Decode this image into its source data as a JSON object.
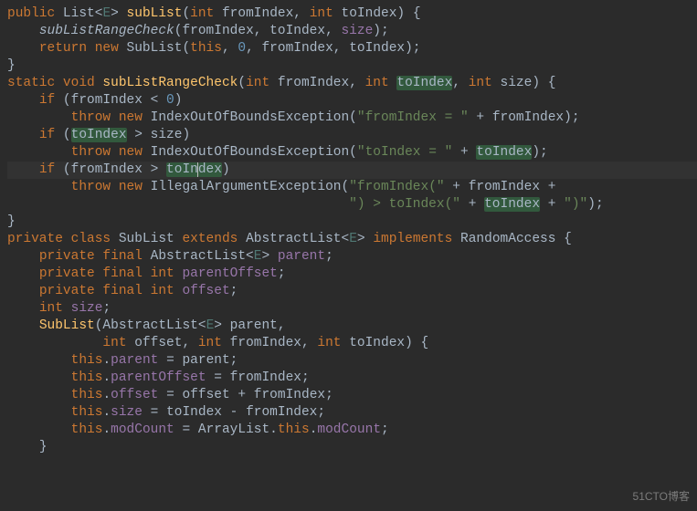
{
  "watermark": "51CTO博客",
  "highlighted_identifier": "toIndex",
  "cursor": {
    "line_index": 10,
    "col": 27
  },
  "code_lines": [
    {
      "indent": 0,
      "tokens": [
        {
          "t": "public ",
          "c": "kw"
        },
        {
          "t": "List",
          "c": "type"
        },
        {
          "t": "<",
          "c": ""
        },
        {
          "t": "E",
          "c": "gen"
        },
        {
          "t": "> ",
          "c": ""
        },
        {
          "t": "subList",
          "c": "mdef"
        },
        {
          "t": "(",
          "c": ""
        },
        {
          "t": "int ",
          "c": "kw"
        },
        {
          "t": "fromIndex, ",
          "c": ""
        },
        {
          "t": "int ",
          "c": "kw"
        },
        {
          "t": "toIndex) {",
          "c": ""
        }
      ]
    },
    {
      "indent": 4,
      "tokens": [
        {
          "t": "subListRangeCheck",
          "c": "ital"
        },
        {
          "t": "(fromIndex, toIndex, ",
          "c": ""
        },
        {
          "t": "size",
          "c": "field"
        },
        {
          "t": ");",
          "c": ""
        }
      ]
    },
    {
      "indent": 4,
      "tokens": [
        {
          "t": "return new ",
          "c": "kw"
        },
        {
          "t": "SubList(",
          "c": ""
        },
        {
          "t": "this",
          "c": "kw"
        },
        {
          "t": ", ",
          "c": ""
        },
        {
          "t": "0",
          "c": "num"
        },
        {
          "t": ", fromIndex, toIndex);",
          "c": ""
        }
      ]
    },
    {
      "indent": 0,
      "tokens": [
        {
          "t": "}",
          "c": ""
        }
      ]
    },
    {
      "indent": 0,
      "tokens": []
    },
    {
      "indent": 0,
      "tokens": [
        {
          "t": "static void ",
          "c": "kw"
        },
        {
          "t": "subListRangeCheck",
          "c": "mdef"
        },
        {
          "t": "(",
          "c": ""
        },
        {
          "t": "int ",
          "c": "kw"
        },
        {
          "t": "fromIndex, ",
          "c": ""
        },
        {
          "t": "int ",
          "c": "kw"
        },
        {
          "t": "toIndex",
          "c": "hl"
        },
        {
          "t": ", ",
          "c": ""
        },
        {
          "t": "int ",
          "c": "kw"
        },
        {
          "t": "size) {",
          "c": ""
        }
      ]
    },
    {
      "indent": 4,
      "tokens": [
        {
          "t": "if ",
          "c": "kw"
        },
        {
          "t": "(fromIndex < ",
          "c": ""
        },
        {
          "t": "0",
          "c": "num"
        },
        {
          "t": ")",
          "c": ""
        }
      ]
    },
    {
      "indent": 8,
      "tokens": [
        {
          "t": "throw new ",
          "c": "kw"
        },
        {
          "t": "IndexOutOfBoundsException(",
          "c": ""
        },
        {
          "t": "\"fromIndex = \"",
          "c": "str"
        },
        {
          "t": " + fromIndex);",
          "c": ""
        }
      ]
    },
    {
      "indent": 4,
      "tokens": [
        {
          "t": "if ",
          "c": "kw"
        },
        {
          "t": "(",
          "c": ""
        },
        {
          "t": "toIndex",
          "c": "hl"
        },
        {
          "t": " > size)",
          "c": ""
        }
      ]
    },
    {
      "indent": 8,
      "tokens": [
        {
          "t": "throw new ",
          "c": "kw"
        },
        {
          "t": "IndexOutOfBoundsException(",
          "c": ""
        },
        {
          "t": "\"toIndex = \"",
          "c": "str"
        },
        {
          "t": " + ",
          "c": ""
        },
        {
          "t": "toIndex",
          "c": "hl"
        },
        {
          "t": ");",
          "c": ""
        }
      ]
    },
    {
      "indent": 4,
      "current": true,
      "tokens": [
        {
          "t": "if ",
          "c": "kw"
        },
        {
          "t": "(fromIndex > ",
          "c": ""
        },
        {
          "t": "toIn",
          "c": "hl"
        },
        {
          "t": "",
          "c": "caret"
        },
        {
          "t": "dex",
          "c": "hl"
        },
        {
          "t": ")",
          "c": ""
        }
      ]
    },
    {
      "indent": 8,
      "tokens": [
        {
          "t": "throw new ",
          "c": "kw"
        },
        {
          "t": "IllegalArgumentException(",
          "c": ""
        },
        {
          "t": "\"fromIndex(\"",
          "c": "str"
        },
        {
          "t": " + fromIndex +",
          "c": ""
        }
      ]
    },
    {
      "indent": 43,
      "tokens": [
        {
          "t": "\") > toIndex(\"",
          "c": "str"
        },
        {
          "t": " + ",
          "c": ""
        },
        {
          "t": "toIndex",
          "c": "hl"
        },
        {
          "t": " + ",
          "c": ""
        },
        {
          "t": "\")\"",
          "c": "str"
        },
        {
          "t": ");",
          "c": ""
        }
      ]
    },
    {
      "indent": 0,
      "tokens": [
        {
          "t": "}",
          "c": ""
        }
      ]
    },
    {
      "indent": 0,
      "tokens": []
    },
    {
      "indent": 0,
      "tokens": [
        {
          "t": "private class ",
          "c": "kw"
        },
        {
          "t": "SubList ",
          "c": "type"
        },
        {
          "t": "extends ",
          "c": "kw"
        },
        {
          "t": "AbstractList<",
          "c": "type"
        },
        {
          "t": "E",
          "c": "gen"
        },
        {
          "t": "> ",
          "c": ""
        },
        {
          "t": "implements ",
          "c": "kw"
        },
        {
          "t": "RandomAccess {",
          "c": "type"
        }
      ]
    },
    {
      "indent": 4,
      "tokens": [
        {
          "t": "private final ",
          "c": "kw"
        },
        {
          "t": "AbstractList<",
          "c": "type"
        },
        {
          "t": "E",
          "c": "gen"
        },
        {
          "t": "> ",
          "c": ""
        },
        {
          "t": "parent",
          "c": "field"
        },
        {
          "t": ";",
          "c": ""
        }
      ]
    },
    {
      "indent": 4,
      "tokens": [
        {
          "t": "private final int ",
          "c": "kw"
        },
        {
          "t": "parentOffset",
          "c": "field"
        },
        {
          "t": ";",
          "c": ""
        }
      ]
    },
    {
      "indent": 4,
      "tokens": [
        {
          "t": "private final int ",
          "c": "kw"
        },
        {
          "t": "offset",
          "c": "field"
        },
        {
          "t": ";",
          "c": ""
        }
      ]
    },
    {
      "indent": 4,
      "tokens": [
        {
          "t": "int ",
          "c": "kw"
        },
        {
          "t": "size",
          "c": "field"
        },
        {
          "t": ";",
          "c": ""
        }
      ]
    },
    {
      "indent": 0,
      "tokens": []
    },
    {
      "indent": 4,
      "tokens": [
        {
          "t": "SubList",
          "c": "mdef"
        },
        {
          "t": "(AbstractList<",
          "c": ""
        },
        {
          "t": "E",
          "c": "gen"
        },
        {
          "t": "> parent,",
          "c": ""
        }
      ]
    },
    {
      "indent": 12,
      "tokens": [
        {
          "t": "int ",
          "c": "kw"
        },
        {
          "t": "offset, ",
          "c": ""
        },
        {
          "t": "int ",
          "c": "kw"
        },
        {
          "t": "fromIndex, ",
          "c": ""
        },
        {
          "t": "int ",
          "c": "kw"
        },
        {
          "t": "toIndex) {",
          "c": ""
        }
      ]
    },
    {
      "indent": 8,
      "tokens": [
        {
          "t": "this",
          "c": "kw"
        },
        {
          "t": ".",
          "c": ""
        },
        {
          "t": "parent ",
          "c": "field"
        },
        {
          "t": "= parent;",
          "c": ""
        }
      ]
    },
    {
      "indent": 8,
      "tokens": [
        {
          "t": "this",
          "c": "kw"
        },
        {
          "t": ".",
          "c": ""
        },
        {
          "t": "parentOffset ",
          "c": "field"
        },
        {
          "t": "= fromIndex;",
          "c": ""
        }
      ]
    },
    {
      "indent": 8,
      "tokens": [
        {
          "t": "this",
          "c": "kw"
        },
        {
          "t": ".",
          "c": ""
        },
        {
          "t": "offset ",
          "c": "field"
        },
        {
          "t": "= offset + fromIndex;",
          "c": ""
        }
      ]
    },
    {
      "indent": 8,
      "tokens": [
        {
          "t": "this",
          "c": "kw"
        },
        {
          "t": ".",
          "c": ""
        },
        {
          "t": "size ",
          "c": "field"
        },
        {
          "t": "= toIndex - fromIndex;",
          "c": ""
        }
      ]
    },
    {
      "indent": 8,
      "tokens": [
        {
          "t": "this",
          "c": "kw"
        },
        {
          "t": ".",
          "c": ""
        },
        {
          "t": "modCount ",
          "c": "field"
        },
        {
          "t": "= ArrayList.",
          "c": ""
        },
        {
          "t": "this",
          "c": "kw"
        },
        {
          "t": ".",
          "c": ""
        },
        {
          "t": "modCount",
          "c": "field"
        },
        {
          "t": ";",
          "c": ""
        }
      ]
    },
    {
      "indent": 4,
      "tokens": [
        {
          "t": "}",
          "c": ""
        }
      ]
    }
  ]
}
